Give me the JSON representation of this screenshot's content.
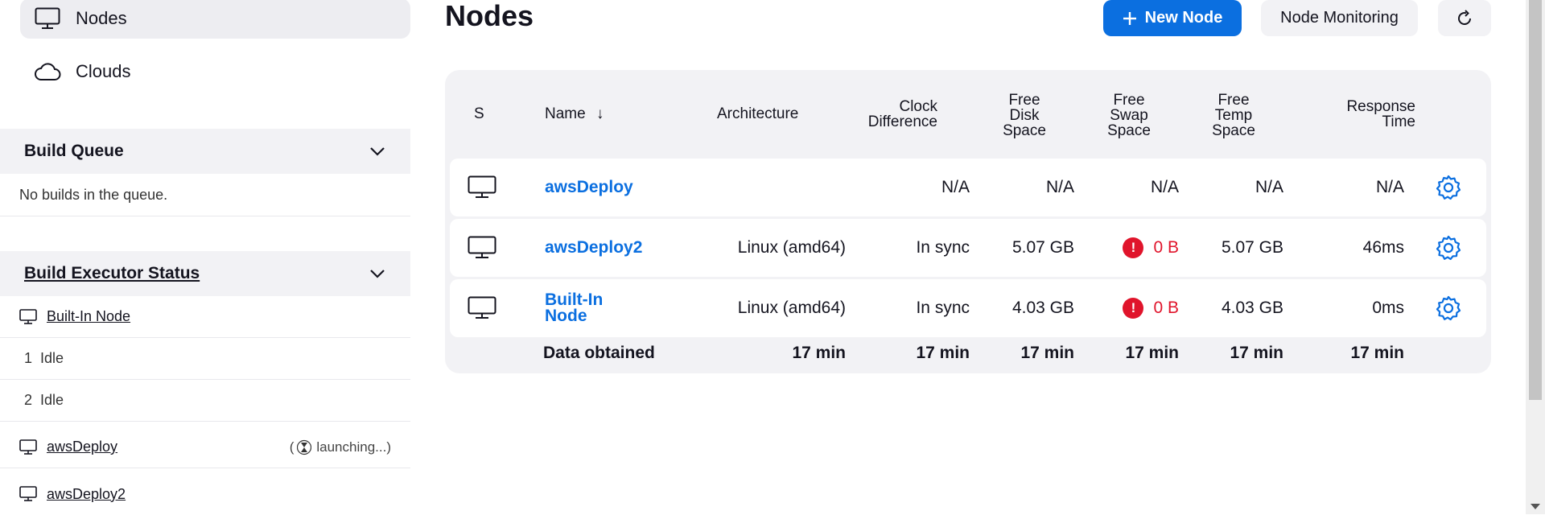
{
  "sidebar": {
    "nav": [
      {
        "label": "Nodes",
        "icon": "computer-icon",
        "active": true
      },
      {
        "label": "Clouds",
        "icon": "cloud-icon",
        "active": false
      }
    ],
    "build_queue": {
      "title": "Build Queue",
      "empty_text": "No builds in the queue."
    },
    "executor_status": {
      "title": "Build Executor Status",
      "nodes": [
        {
          "name": "Built-In Node",
          "executors": [
            {
              "num": "1",
              "state": "Idle"
            },
            {
              "num": "2",
              "state": "Idle"
            }
          ]
        },
        {
          "name": "awsDeploy",
          "status": "launching...",
          "status_open": "(",
          "status_close": ")"
        },
        {
          "name": "awsDeploy2"
        }
      ]
    }
  },
  "main": {
    "title": "Nodes",
    "new_node_label": "New Node",
    "monitoring_label": "Node Monitoring",
    "columns": {
      "s": "S",
      "name": "Name",
      "sort_arrow": "↓",
      "architecture": "Architecture",
      "clock": [
        "Clock",
        "Difference"
      ],
      "disk": [
        "Free",
        "Disk",
        "Space"
      ],
      "swap": [
        "Free",
        "Swap",
        "Space"
      ],
      "temp": [
        "Free",
        "Temp",
        "Space"
      ],
      "response": [
        "Response",
        "Time"
      ]
    },
    "rows": [
      {
        "name": "awsDeploy",
        "architecture": "",
        "clock": "N/A",
        "disk": "N/A",
        "swap": "N/A",
        "swap_error": false,
        "temp": "N/A",
        "response": "N/A"
      },
      {
        "name": "awsDeploy2",
        "architecture": "Linux (amd64)",
        "clock": "In sync",
        "disk": "5.07 GB",
        "swap": "0 B",
        "swap_error": true,
        "temp": "5.07 GB",
        "response": "46ms"
      },
      {
        "name_line1": "Built-In",
        "name_line2": "Node",
        "architecture": "Linux (amd64)",
        "clock": "In sync",
        "disk": "4.03 GB",
        "swap": "0 B",
        "swap_error": true,
        "temp": "4.03 GB",
        "response": "0ms"
      }
    ],
    "footer": {
      "label": "Data obtained",
      "architecture": "17 min",
      "clock": "17 min",
      "disk": "17 min",
      "swap": "17 min",
      "temp": "17 min",
      "response": "17 min"
    },
    "error_mark": "!"
  },
  "colors": {
    "accent": "#0b6fe0",
    "error": "#e0142b",
    "panel": "#f2f2f5"
  }
}
